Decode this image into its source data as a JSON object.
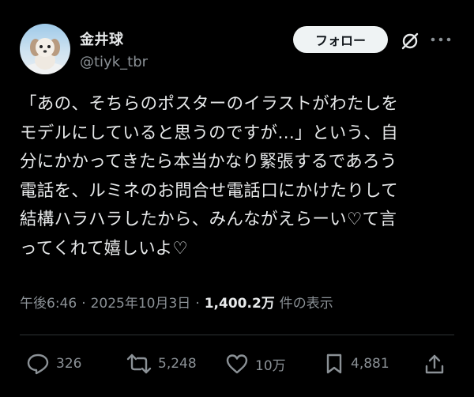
{
  "user": {
    "display_name": "金井球",
    "handle": "@tiyk_tbr",
    "avatar_icon": "dog-avatar"
  },
  "header": {
    "follow_label": "フォロー",
    "grok_icon": "grok-icon",
    "more_icon": "more-icon"
  },
  "tweet": {
    "lines": [
      "「あの、そちらのポスターのイラストがわたしを",
      "モデルにしていると思うのですが…」という、自",
      "分にかかってきたら本当かなり緊張するであろう",
      "電話を、ルミネのお問合せ電話口にかけたりして",
      "結構ハラハラしたから、みんながえらーい♡て言",
      "ってくれて嬉しいよ♡"
    ]
  },
  "meta": {
    "time": "午後6:46",
    "date": "2025年10月3日",
    "views_count": "1,400.2万",
    "views_label": "件の表示"
  },
  "actions": {
    "replies": "326",
    "reposts": "5,248",
    "likes": "10万",
    "bookmarks": "4,881"
  },
  "colors": {
    "background": "#000000",
    "text": "#e7e9ea",
    "secondary": "#8b9196",
    "follow_bg": "#eff3f4",
    "divider": "#2f3336"
  }
}
